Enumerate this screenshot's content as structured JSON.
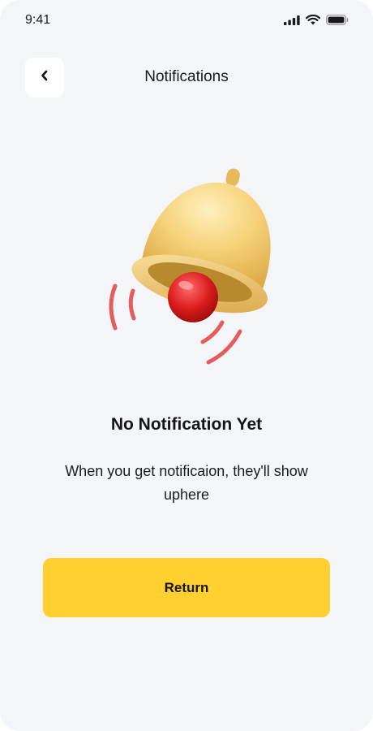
{
  "status_bar": {
    "time": "9:41",
    "icons": [
      "signal-icon",
      "wifi-icon",
      "battery-icon"
    ]
  },
  "header": {
    "back_icon": "chevron-left-icon",
    "title": "Notifications"
  },
  "empty_state": {
    "illustration": "bell-icon",
    "title": "No  Notification Yet",
    "message": "When you get notificaion, they'll show uphere"
  },
  "actions": {
    "return_label": "Return"
  },
  "colors": {
    "background": "#f4f5f9",
    "accent": "#ffd02f",
    "bell": "#f0c65f",
    "clapper": "#d81b1b",
    "motion_lines": "#e35d5d"
  }
}
